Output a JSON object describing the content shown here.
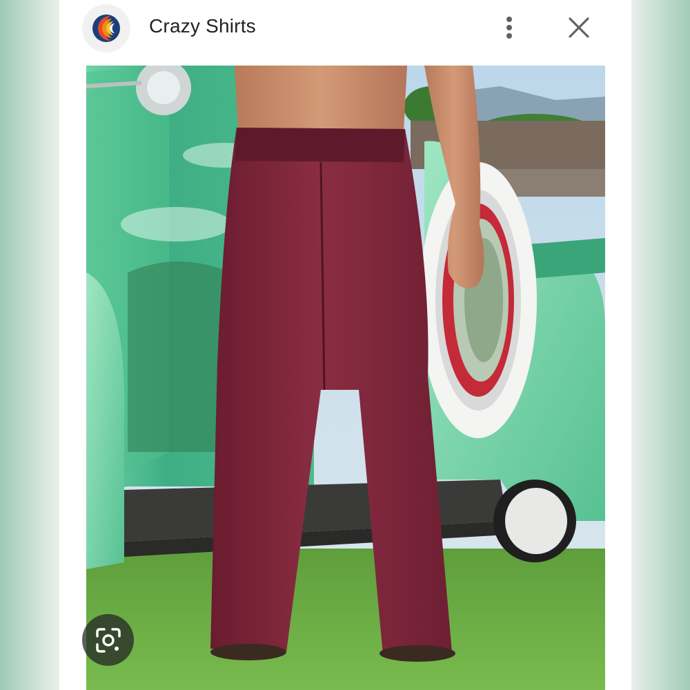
{
  "header": {
    "app_name": "Crazy Shirts",
    "app_icon": "crazy-shirts-logo-icon",
    "more_icon": "more-vertical-icon",
    "close_icon": "close-icon"
  },
  "image": {
    "lens_icon": "google-lens-icon"
  },
  "colors": {
    "truck_green": "#5fc79b",
    "pants_maroon": "#7a2437",
    "grass": "#6fb04a",
    "logo_blue": "#1c3f7a",
    "logo_orange": "#f28a1b"
  }
}
